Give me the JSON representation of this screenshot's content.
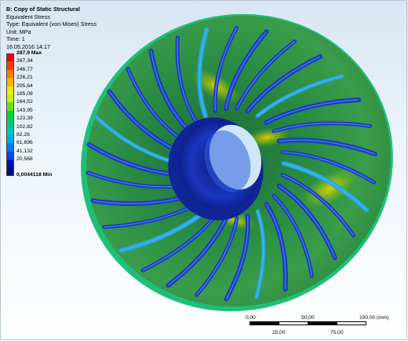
{
  "analysis": {
    "title": "B: Copy of Static Structural",
    "result": "Equivalent Stress",
    "type": "Type: Equivalent (von-Mises) Stress",
    "unit": "Unit: MPa",
    "time": "Time: 1",
    "timestamp": "16.05.2016 14:17"
  },
  "legend": {
    "entries": [
      {
        "label": "287,9 Max",
        "color": "#e8000b",
        "bold": true
      },
      {
        "label": "267,34",
        "color": "#ff3a00"
      },
      {
        "label": "246,77",
        "color": "#ff7b00"
      },
      {
        "label": "226,21",
        "color": "#ffb400"
      },
      {
        "label": "205,64",
        "color": "#ffe600"
      },
      {
        "label": "185,08",
        "color": "#c8f000"
      },
      {
        "label": "164,52",
        "color": "#6fe200"
      },
      {
        "label": "143,95",
        "color": "#00d23c"
      },
      {
        "label": "123,39",
        "color": "#00c87a"
      },
      {
        "label": "102,82",
        "color": "#00c8be"
      },
      {
        "label": "82,26",
        "color": "#00aee6"
      },
      {
        "label": "61,696",
        "color": "#0078f0"
      },
      {
        "label": "41,132",
        "color": "#0043e6"
      },
      {
        "label": "20,568",
        "color": "#0014b4"
      },
      {
        "label": "0,0044118 Min",
        "color": "#000c78",
        "bold": true
      }
    ]
  },
  "scale_bar": {
    "top_labels": [
      "0,00",
      "50,00",
      "100,00 (mm)"
    ],
    "bottom_labels": [
      "25,00",
      "75,00"
    ]
  },
  "colors": {
    "disk": "#2a8a3e",
    "blade": "#1e3fbf",
    "hub": "#1226a8",
    "hot": "#e3c200"
  }
}
